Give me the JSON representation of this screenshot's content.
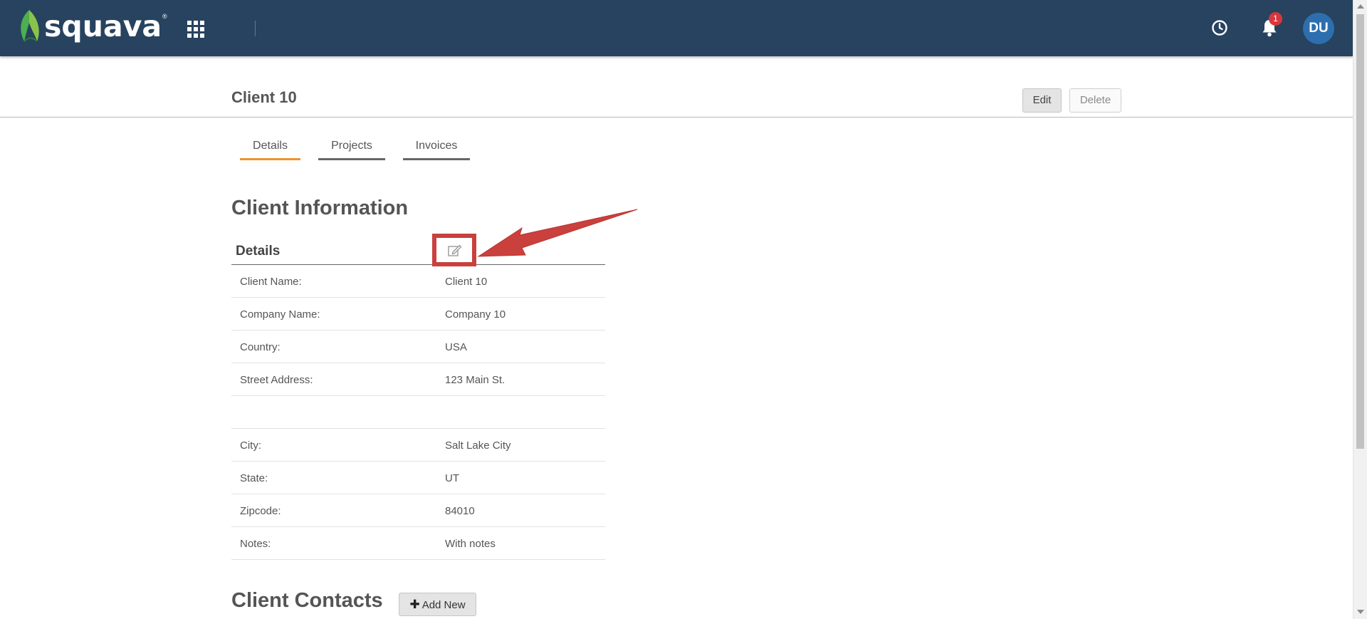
{
  "app": {
    "logo_text": "squava",
    "logo_reg": "®",
    "notification_count": "1",
    "user_initials": "DU"
  },
  "header": {
    "title": "Client 10",
    "edit_label": "Edit",
    "delete_label": "Delete"
  },
  "tabs": [
    {
      "label": "Details",
      "active": true
    },
    {
      "label": "Projects",
      "active": false
    },
    {
      "label": "Invoices",
      "active": false
    }
  ],
  "client_information": {
    "title": "Client Information",
    "details_heading": "Details",
    "rows": [
      {
        "label": "Client Name:",
        "value": "Client 10"
      },
      {
        "label": "Company Name:",
        "value": "Company 10"
      },
      {
        "label": "Country:",
        "value": "USA"
      },
      {
        "label": "Street Address:",
        "value": "123 Main St."
      },
      {
        "label": "",
        "value": ""
      },
      {
        "label": "City:",
        "value": "Salt Lake City"
      },
      {
        "label": "State:",
        "value": "UT"
      },
      {
        "label": "Zipcode:",
        "value": "84010"
      },
      {
        "label": "Notes:",
        "value": "With notes"
      }
    ]
  },
  "client_contacts": {
    "title": "Client Contacts",
    "add_label": "Add New"
  },
  "icons": {
    "apps": "grid-icon",
    "history": "clock-icon",
    "notifications": "bell-icon",
    "edit_details": "edit-icon",
    "add": "plus-icon"
  },
  "colors": {
    "topbar": "#27435f",
    "active_tab": "#f0932b",
    "annotation": "#c9403d",
    "avatar": "#2d6fae",
    "badge": "#d9363e"
  }
}
